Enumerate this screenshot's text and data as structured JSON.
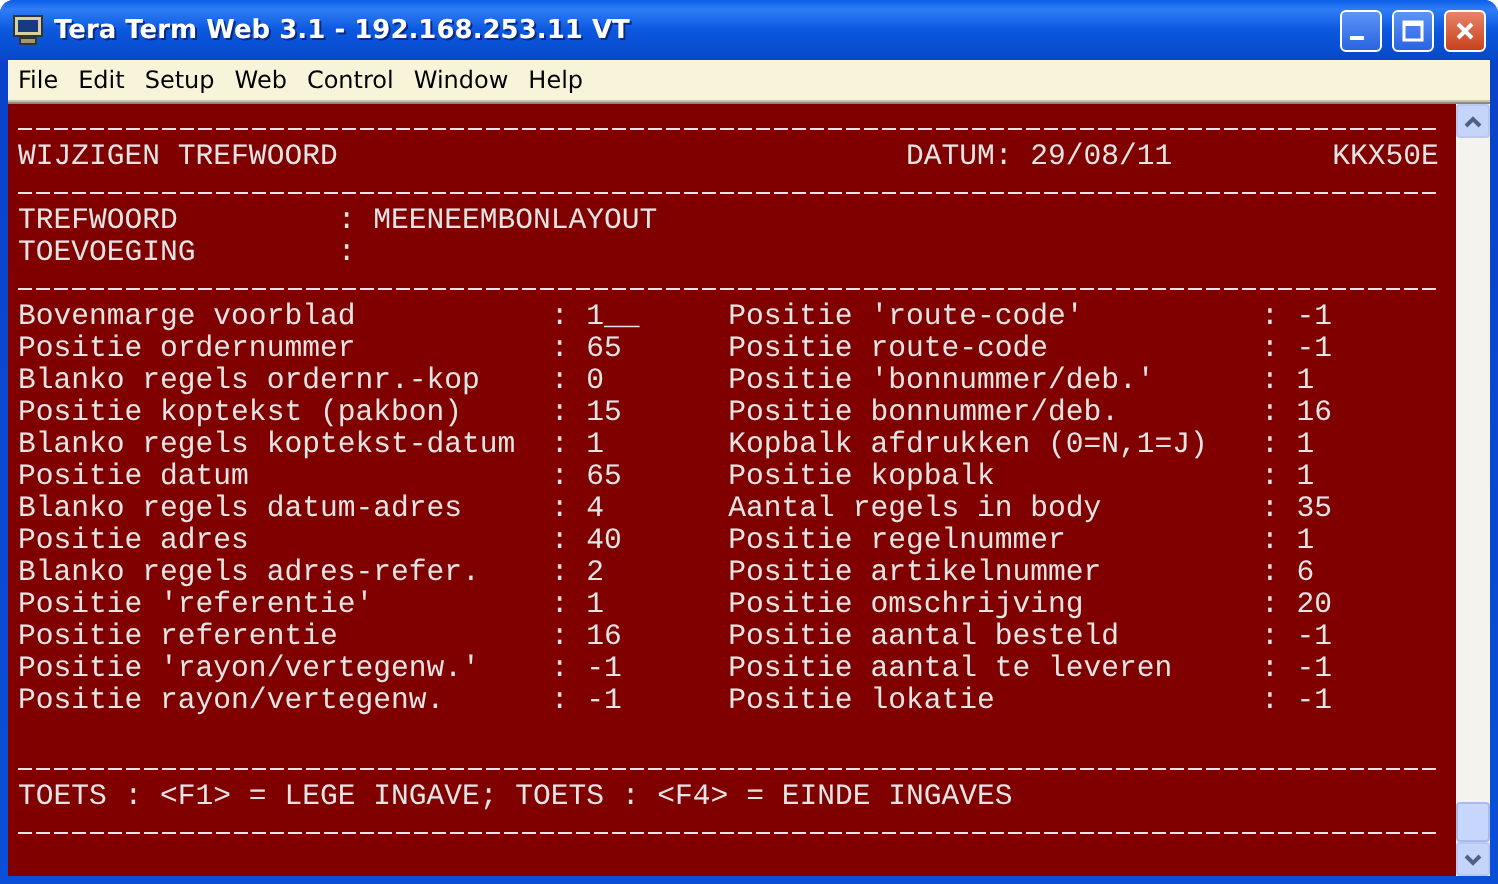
{
  "window": {
    "title": "Tera Term Web 3.1 - 192.168.253.11 VT"
  },
  "menu": [
    "File",
    "Edit",
    "Setup",
    "Web",
    "Control",
    "Window",
    "Help"
  ],
  "terminal": {
    "header": {
      "title": "WIJZIGEN TREFWOORD",
      "date": "DATUM: 29/08/11",
      "code": "KKX50E"
    },
    "separator": ":",
    "keys": [
      {
        "label": "TREFWOORD",
        "value": "MEENEEMBONLAYOUT"
      },
      {
        "label": "TOEVOEGING"
      }
    ],
    "fields_left": [
      {
        "label": "Bovenmarge voorblad",
        "value": "1__"
      },
      {
        "label": "Positie ordernummer",
        "value": "65"
      },
      {
        "label": "Blanko regels ordernr.-kop",
        "value": "0"
      },
      {
        "label": "Positie koptekst (pakbon)",
        "value": "15"
      },
      {
        "label": "Blanko regels koptekst-datum",
        "value": "1"
      },
      {
        "label": "Positie datum",
        "value": "65"
      },
      {
        "label": "Blanko regels datum-adres",
        "value": "4"
      },
      {
        "label": "Positie adres",
        "value": "40"
      },
      {
        "label": "Blanko regels adres-refer.",
        "value": "2"
      },
      {
        "label": "Positie 'referentie'",
        "value": "1"
      },
      {
        "label": "Positie referentie",
        "value": "16"
      },
      {
        "label": "Positie 'rayon/vertegenw.'",
        "value": "-1"
      },
      {
        "label": "Positie rayon/vertegenw.",
        "value": "-1"
      }
    ],
    "fields_right": [
      {
        "label": "Positie 'route-code'",
        "value": "-1"
      },
      {
        "label": "Positie route-code",
        "value": "-1"
      },
      {
        "label": "Positie 'bonnummer/deb.'",
        "value": "1"
      },
      {
        "label": "Positie bonnummer/deb.",
        "value": "16"
      },
      {
        "label": "Kopbalk afdrukken (0=N,1=J)",
        "value": "1"
      },
      {
        "label": "Positie kopbalk",
        "value": "1"
      },
      {
        "label": "Aantal regels in body",
        "value": "35"
      },
      {
        "label": "Positie regelnummer",
        "value": "1"
      },
      {
        "label": "Positie artikelnummer",
        "value": "6"
      },
      {
        "label": "Positie omschrijving",
        "value": "20"
      },
      {
        "label": "Positie aantal besteld",
        "value": "-1"
      },
      {
        "label": "Positie aantal te leveren",
        "value": "-1"
      },
      {
        "label": "Positie lokatie",
        "value": "-1"
      }
    ],
    "footer": "TOETS : <F1> = LEGE INGAVE; TOETS : <F4> = EINDE INGAVES"
  }
}
